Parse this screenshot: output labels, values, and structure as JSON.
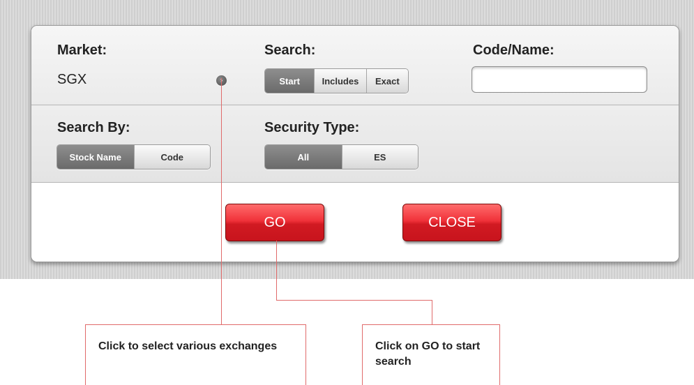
{
  "market": {
    "label": "Market:",
    "value": "SGX",
    "selector_icon": "disclosure-arrow-icon"
  },
  "search": {
    "label": "Search:",
    "options": [
      "Start",
      "Includes",
      "Exact"
    ],
    "selected": "Start"
  },
  "code_name": {
    "label": "Code/Name:",
    "value": "",
    "placeholder": ""
  },
  "search_by": {
    "label": "Search By:",
    "options": [
      "Stock Name",
      "Code"
    ],
    "selected": "Stock Name"
  },
  "security_type": {
    "label": "Security Type:",
    "options": [
      "All",
      "ES"
    ],
    "selected": "All"
  },
  "buttons": {
    "go": "GO",
    "close": "CLOSE"
  },
  "callouts": {
    "exchange": "Click to select various exchanges",
    "go": "Click on GO to start search"
  },
  "colors": {
    "accent_red": "#e8232b",
    "segment_selected": "#7a7a7a",
    "callout_line": "#e06a6a"
  }
}
